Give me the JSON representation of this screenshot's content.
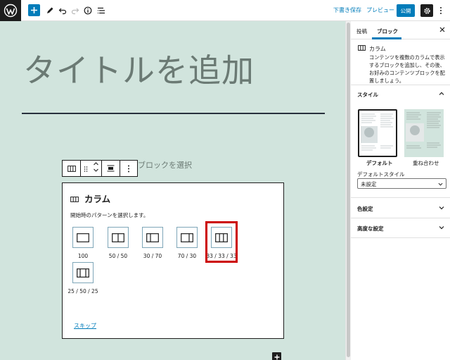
{
  "toolbar": {
    "save_draft": "下書き保存",
    "preview": "プレビュー",
    "publish": "公開"
  },
  "editor": {
    "post_title": "タイトルを追加",
    "ghost_text": "ブロックを選択"
  },
  "columns_placeholder": {
    "title": "カラム",
    "instructions": "開始時のパターンを選択します。",
    "variations": [
      {
        "label": "100",
        "icon": "columns-100-icon"
      },
      {
        "label": "50 / 50",
        "icon": "columns-50-50-icon"
      },
      {
        "label": "30 / 70",
        "icon": "columns-30-70-icon"
      },
      {
        "label": "70 / 30",
        "icon": "columns-70-30-icon"
      },
      {
        "label": "33 / 33 / 33",
        "icon": "columns-33-33-33-icon"
      },
      {
        "label": "25 / 50 / 25",
        "icon": "columns-25-50-25-icon"
      }
    ],
    "highlighted": "33 / 33 / 33",
    "skip": "スキップ"
  },
  "sidebar": {
    "tabs": [
      "投稿",
      "ブロック"
    ],
    "active_tab": "ブロック",
    "block": {
      "name": "カラム",
      "description": "コンテンツを複数のカラムで表示するブロックを追加し、その後、お好みのコンテンツブロックを配置しましょう。"
    },
    "sections": {
      "style": "スタイル",
      "color": "色設定",
      "advanced": "高度な設定"
    },
    "styles": [
      "デフォルト",
      "重ね合わせ"
    ],
    "default_style_label": "デフォルトスタイル",
    "default_style_value": "未設定"
  },
  "colors": {
    "accent": "#007cba",
    "canvas_bg": "#d1e4dd",
    "highlight": "#cc0000"
  }
}
